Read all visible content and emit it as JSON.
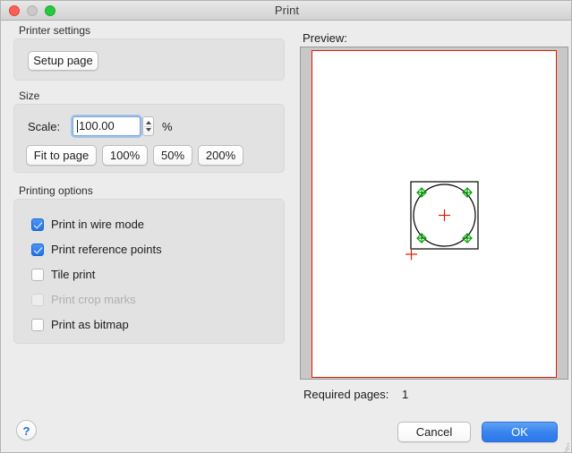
{
  "window": {
    "title": "Print",
    "traffic_lights": {
      "close": "close-button",
      "minimize": "minimize-button",
      "maximize": "maximize-button"
    }
  },
  "printer_settings": {
    "group_label": "Printer settings",
    "setup_page_label": "Setup page"
  },
  "size": {
    "group_label": "Size",
    "scale_label": "Scale:",
    "scale_value": "100.00",
    "scale_placeholder": "100.00",
    "percent_label": "%",
    "presets": [
      {
        "label": "Fit to page"
      },
      {
        "label": "100%"
      },
      {
        "label": "50%"
      },
      {
        "label": "200%"
      }
    ]
  },
  "printing_options": {
    "group_label": "Printing options",
    "items": [
      {
        "label": "Print in wire mode",
        "checked": true,
        "disabled": false
      },
      {
        "label": "Print reference points",
        "checked": true,
        "disabled": false
      },
      {
        "label": "Tile print",
        "checked": false,
        "disabled": false
      },
      {
        "label": "Print crop marks",
        "checked": false,
        "disabled": true
      },
      {
        "label": "Print as bitmap",
        "checked": false,
        "disabled": false
      }
    ]
  },
  "preview": {
    "label": "Preview:",
    "page_border_color": "#e01b00",
    "drawing": {
      "square_color": "#000000",
      "circle_color": "#000000",
      "reference_point_color": "#00a000",
      "crosshair_color": "#e01b00",
      "reference_points": 4,
      "center_marker": "crosshair",
      "origin_marker": "crosshair"
    }
  },
  "footer": {
    "required_pages_label": "Required pages:",
    "required_pages_value": "1",
    "cancel_label": "Cancel",
    "ok_label": "OK",
    "help_label": "?"
  },
  "colors": {
    "accent": "#2c78ec",
    "checkbox_on": "#1f74ea",
    "window_bg": "#ececec",
    "group_bg": "#e2e2e2",
    "preview_bg": "#c8c8c8"
  }
}
